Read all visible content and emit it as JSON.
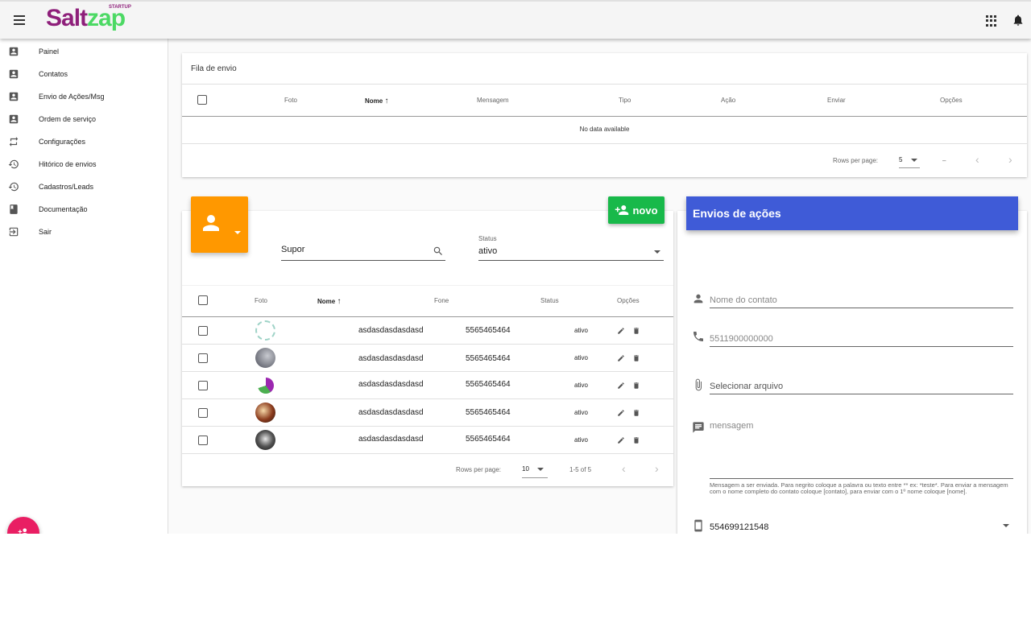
{
  "app": {
    "logo_salt": "Salt",
    "logo_zap": "zap",
    "logo_badge": "STARTUP"
  },
  "sidebar": {
    "items": [
      {
        "label": "Painel",
        "icon": "account-box-icon"
      },
      {
        "label": "Contatos",
        "icon": "account-box-icon"
      },
      {
        "label": "Envio de Ações/Msg",
        "icon": "account-box-icon"
      },
      {
        "label": "Ordem de serviço",
        "icon": "account-box-icon"
      },
      {
        "label": "Configurações",
        "icon": "swap-icon"
      },
      {
        "label": "Hitórico de envios",
        "icon": "history-icon"
      },
      {
        "label": "Cadastros/Leads",
        "icon": "history-icon"
      },
      {
        "label": "Documentação",
        "icon": "book-icon"
      },
      {
        "label": "Sair",
        "icon": "logout-icon"
      }
    ]
  },
  "queue": {
    "title": "Fila de envio",
    "headers": {
      "foto": "Foto",
      "nome": "Nome",
      "mensagem": "Mensagem",
      "tipo": "Tipo",
      "acao": "Ação",
      "enviar": "Enviar",
      "opcoes": "Opções"
    },
    "empty": "No data available",
    "rows_per_page_label": "Rows per page:",
    "rows_per_page": "5",
    "range": "–"
  },
  "contacts": {
    "new_button": "novo",
    "search_value": "Supor",
    "status_label": "Status",
    "status_value": "ativo",
    "headers": {
      "foto": "Foto",
      "nome": "Nome",
      "fone": "Fone",
      "status": "Status",
      "opcoes": "Opções"
    },
    "rows": [
      {
        "name": "asdasdasdasdasd",
        "phone": "5565465464",
        "status": "ativo"
      },
      {
        "name": "asdasdasdasdasd",
        "phone": "5565465464",
        "status": "ativo"
      },
      {
        "name": "asdasdasdasdasd",
        "phone": "5565465464",
        "status": "ativo"
      },
      {
        "name": "asdasdasdasdasd",
        "phone": "5565465464",
        "status": "ativo"
      },
      {
        "name": "asdasdasdasdasd",
        "phone": "5565465464",
        "status": "ativo"
      }
    ],
    "rows_per_page_label": "Rows per page:",
    "rows_per_page": "10",
    "range": "1-5 of 5"
  },
  "actions": {
    "title": "Envios de ações",
    "name_placeholder": "Nome do contato",
    "phone_placeholder": "5511900000000",
    "file_label": "Selecionar arquivo",
    "message_placeholder": "mensagem",
    "hint": "Mensagem a ser enviada. Para negrito coloque a palavra ou texto entre ** ex: *teste*. Para enviar a mensagem com o nome completo do contato coloque [contato], para enviar com o 1º nome coloque [nome].",
    "sender_number": "554699121548"
  },
  "colors": {
    "brand_purple": "#8e1f7a",
    "brand_green": "#4cd964",
    "orange": "#ff9800",
    "green_button": "#18b94a",
    "blue_header": "#3f5bd7",
    "fab_pink": "#e91e63"
  }
}
